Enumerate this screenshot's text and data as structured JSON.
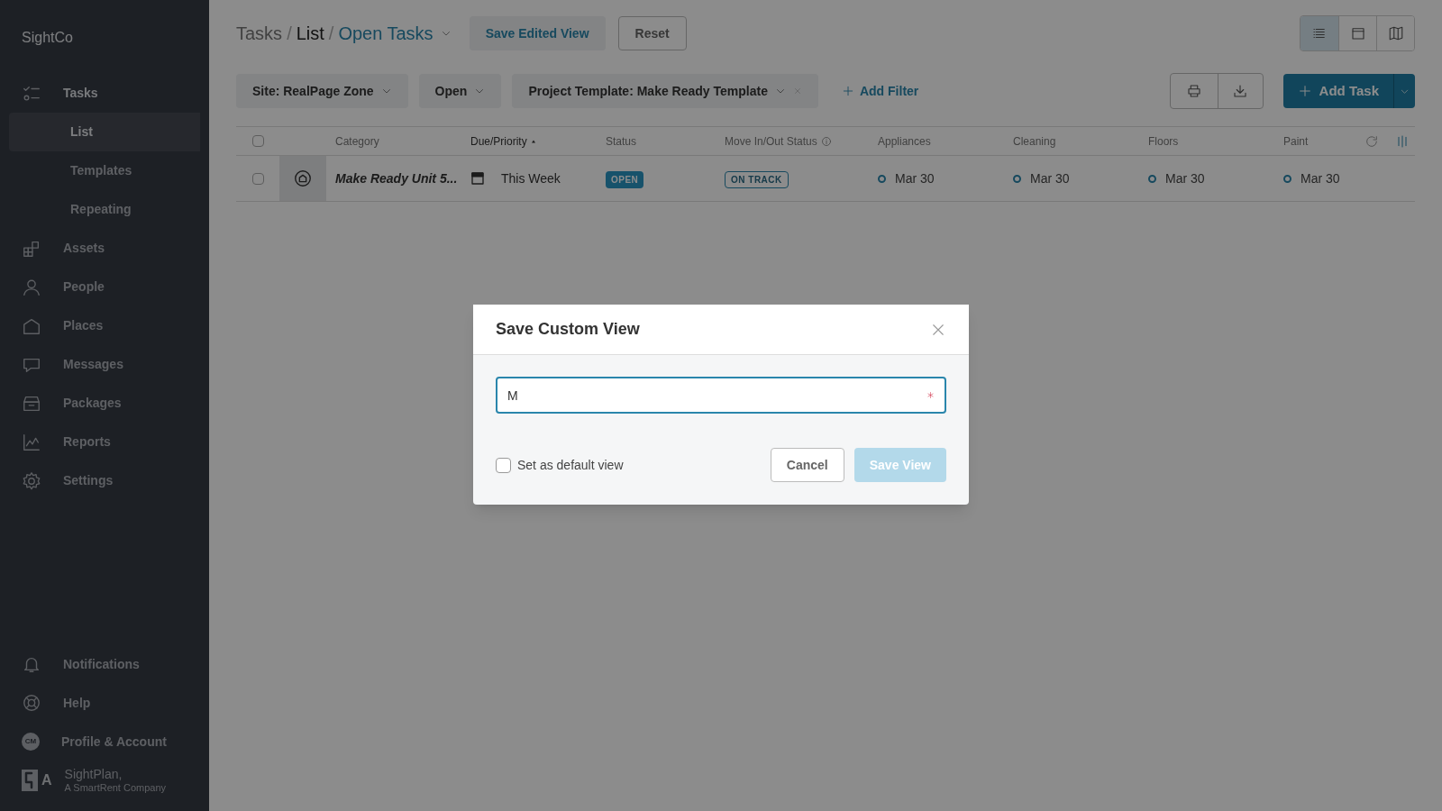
{
  "sidebar": {
    "brand": "SightCo",
    "items": [
      {
        "label": "Tasks",
        "kind": "tasks",
        "selected": false,
        "children": [
          {
            "label": "List",
            "selected": true
          },
          {
            "label": "Templates",
            "selected": false
          },
          {
            "label": "Repeating",
            "selected": false
          }
        ]
      },
      {
        "label": "Assets",
        "kind": "assets",
        "selected": false
      },
      {
        "label": "People",
        "kind": "people",
        "selected": false
      },
      {
        "label": "Places",
        "kind": "places",
        "selected": false
      },
      {
        "label": "Messages",
        "kind": "messages",
        "selected": false
      },
      {
        "label": "Packages",
        "kind": "packages",
        "selected": false
      },
      {
        "label": "Reports",
        "kind": "reports",
        "selected": false
      },
      {
        "label": "Settings",
        "kind": "settings",
        "selected": false
      }
    ],
    "bottom_items": [
      {
        "label": "Notifications",
        "kind": "notifications"
      },
      {
        "label": "Help",
        "kind": "help"
      },
      {
        "label": "Profile & Account",
        "kind": "avatar",
        "initials": "CM"
      }
    ],
    "footer": {
      "logo_letter": "A",
      "name": "SightPlan,",
      "tagline": "A SmartRent Company"
    }
  },
  "header": {
    "breadcrumbs": [
      "Tasks",
      "List"
    ],
    "separator": "/",
    "current_view": "Open Tasks",
    "save_button": "Save Edited View",
    "reset_button": "Reset",
    "view_modes": [
      {
        "kind": "list",
        "selected": true
      },
      {
        "kind": "calendar",
        "selected": false
      },
      {
        "kind": "map",
        "selected": false
      }
    ]
  },
  "filters": [
    {
      "label": "Site: RealPage Zone",
      "removable": false
    },
    {
      "label": "Open",
      "removable": false
    },
    {
      "label": "Project Template: Make Ready Template",
      "removable": true
    }
  ],
  "add_filter": "Add Filter",
  "add_task": "Add Task",
  "table": {
    "select_all_checked": false,
    "columns": [
      {
        "label": "Category",
        "sorted": false,
        "info": false
      },
      {
        "label": "Due/Priority",
        "sorted": true,
        "info": false
      },
      {
        "label": "Status",
        "sorted": false,
        "info": false
      },
      {
        "label": "Move In/Out Status",
        "sorted": false,
        "info": true
      },
      {
        "label": "Appliances",
        "sorted": false,
        "info": false
      },
      {
        "label": "Cleaning",
        "sorted": false,
        "info": false
      },
      {
        "label": "Floors",
        "sorted": false,
        "info": false
      },
      {
        "label": "Paint",
        "sorted": false,
        "info": false
      }
    ],
    "rows": [
      {
        "checked": false,
        "category": "Make Ready Unit 5...",
        "due": "This Week",
        "status": "OPEN",
        "move_status": "ON TRACK",
        "dates": [
          "Mar 30",
          "Mar 30",
          "Mar 30",
          "Mar 30"
        ]
      }
    ]
  },
  "dialog": {
    "title": "Save Custom View",
    "name_value": "M",
    "required": true,
    "default_view": {
      "label": "Set as default view",
      "checked": false
    },
    "cancel": "Cancel",
    "save": {
      "label": "Save View",
      "disabled": true
    }
  }
}
